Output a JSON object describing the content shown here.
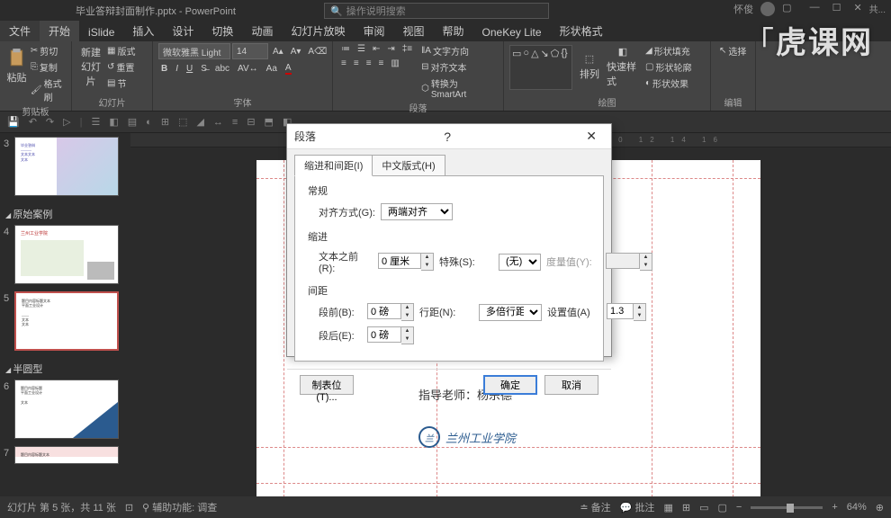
{
  "titlebar": {
    "filename": "毕业答辩封面制作.pptx - PowerPoint",
    "search_placeholder": "操作说明搜索",
    "user": "怀俊",
    "share": "共..."
  },
  "menu": {
    "file": "文件",
    "home": "开始",
    "islide": "iSlide",
    "insert": "插入",
    "design": "设计",
    "transition": "切换",
    "animation": "动画",
    "slideshow": "幻灯片放映",
    "review": "审阅",
    "view": "视图",
    "help": "帮助",
    "onekey": "OneKey Lite",
    "shape_format": "形状格式"
  },
  "ribbon": {
    "clipboard": {
      "label": "剪贴板",
      "paste": "粘贴",
      "cut": "剪切",
      "copy": "复制",
      "format_painter": "格式刷"
    },
    "slides": {
      "label": "幻灯片",
      "new_slide": "新建\n幻灯片",
      "layout": "版式",
      "reset": "重置",
      "section": "节"
    },
    "font": {
      "label": "字体",
      "name": "微软雅黑 Light",
      "size": "14"
    },
    "paragraph": {
      "label": "段落",
      "direction": "文字方向",
      "align": "对齐文本",
      "smartart": "转换为 SmartArt"
    },
    "drawing": {
      "label": "绘图",
      "arrange": "排列",
      "quick_style": "快速样式",
      "shape_fill": "形状填充",
      "shape_outline": "形状轮廓",
      "shape_effects": "形状效果"
    },
    "editing": {
      "label": "编辑",
      "select": "选择"
    }
  },
  "sidebar": {
    "section_original": "原始案例",
    "section_half": "半圆型"
  },
  "canvas": {
    "text_line": "指导老师：杨宗德",
    "logo_text": "兰州工业学院"
  },
  "dialog": {
    "title": "段落",
    "tab1": "缩进和间距(I)",
    "tab2": "中文版式(H)",
    "section_general": "常规",
    "alignment_label": "对齐方式(G):",
    "alignment_value": "两端对齐",
    "section_indent": "缩进",
    "text_before_label": "文本之前(R):",
    "text_before_value": "0 厘米",
    "special_label": "特殊(S):",
    "special_value": "(无)",
    "by_label": "度量值(Y):",
    "section_spacing": "间距",
    "before_label": "段前(B):",
    "before_value": "0 磅",
    "line_spacing_label": "行距(N):",
    "line_spacing_value": "多倍行距",
    "at_label": "设置值(A)",
    "at_value": "1.3",
    "after_label": "段后(E):",
    "after_value": "0 磅",
    "tabstops": "制表位(T)...",
    "ok": "确定",
    "cancel": "取消"
  },
  "statusbar": {
    "slide_info": "幻灯片 第 5 张，共 11 张",
    "accessibility": "辅助功能: 调查",
    "notes": "备注",
    "comments": "批注",
    "zoom": "64%"
  },
  "watermark": "虎课网"
}
